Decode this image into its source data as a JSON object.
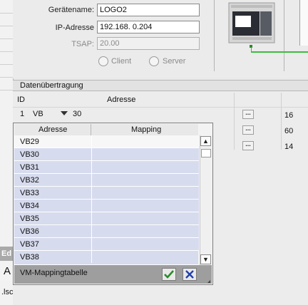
{
  "connection": {
    "device_name_label": "Gerätename:",
    "device_name_value": "LOGO2",
    "ip_label": "IP-Adresse",
    "ip_value": "192.168.  0.204",
    "tsap_label": "TSAP:",
    "tsap_value": "20.00",
    "radio_client": "Client",
    "radio_server": "Server"
  },
  "section_title": "Datenübertragung",
  "table": {
    "col_id": "ID",
    "col_adresse": "Adresse",
    "row1": {
      "id": "1",
      "area": "VB",
      "offset": "30"
    },
    "values": [
      "16",
      "60",
      "14"
    ],
    "dots_label": "..."
  },
  "popup": {
    "col_adresse": "Adresse",
    "col_mapping": "Mapping",
    "rows": [
      "VB29",
      "VB30",
      "VB31",
      "VB32",
      "VB33",
      "VB34",
      "VB35",
      "VB36",
      "VB37",
      "VB38"
    ],
    "footer_title": "VM-Mappingtabelle"
  },
  "left_strip": {
    "label_ed": "Ed",
    "label_a": "A",
    "label_lsc": ".lsc"
  },
  "colors": {
    "row_fill": "#d7dbee",
    "ok_green": "#2a8a2a",
    "cancel_blue": "#1f3fae",
    "plc_screen": "#2a2d33"
  }
}
